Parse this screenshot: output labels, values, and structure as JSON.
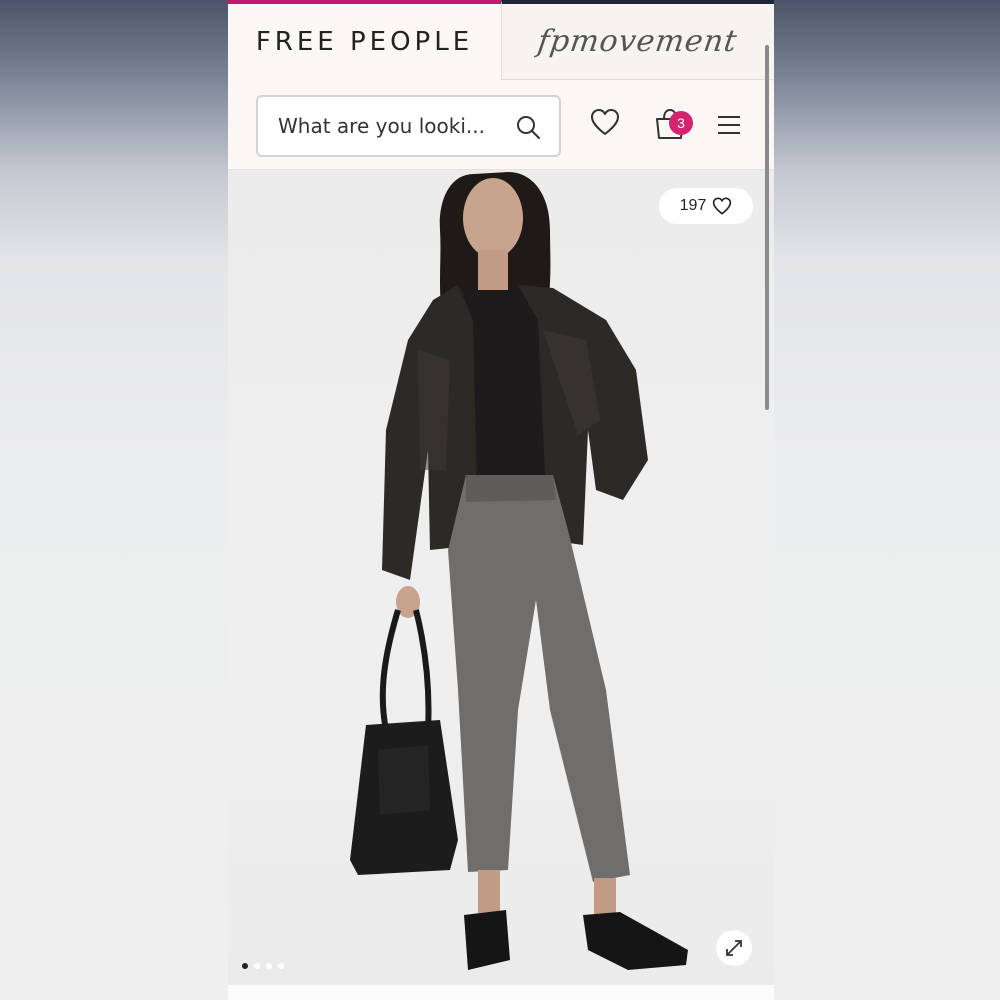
{
  "brand_tabs": {
    "free_people": "FREE PEOPLE",
    "fp_movement": "fpmovement"
  },
  "search": {
    "placeholder": "What are you looki..."
  },
  "cart": {
    "count": "3"
  },
  "product": {
    "like_count": "197",
    "carousel_total": 4,
    "carousel_active": 1
  },
  "colors": {
    "accent_magenta": "#c2186f",
    "cart_badge": "#d4236f",
    "fpm_tab_bar": "#20253a"
  },
  "icons": [
    "search-icon",
    "heart-icon",
    "shopping-bag-icon",
    "hamburger-menu-icon",
    "expand-icon"
  ]
}
